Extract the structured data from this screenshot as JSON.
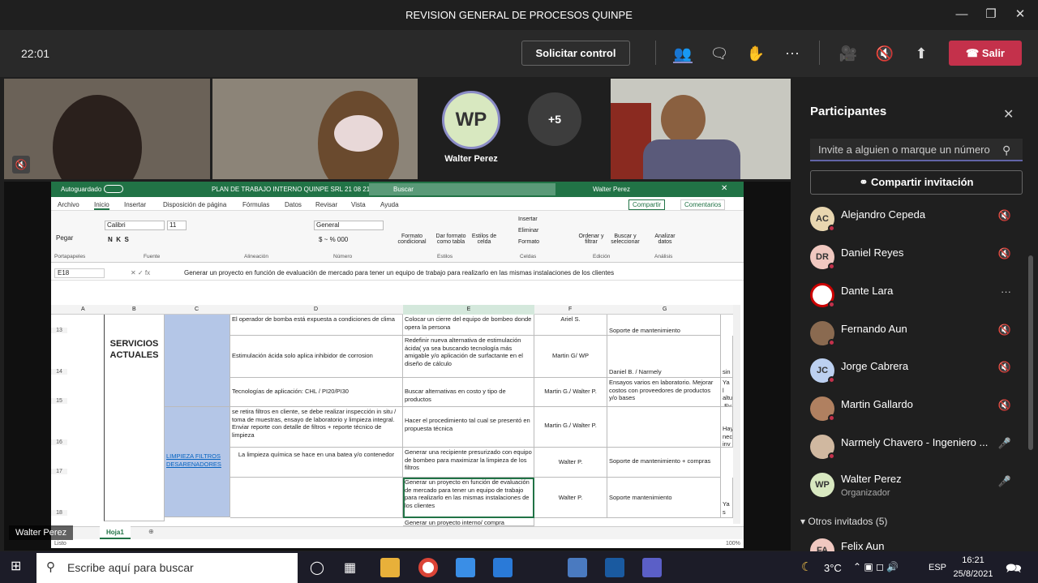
{
  "window": {
    "title": "REVISION GENERAL DE PROCESOS QUINPE"
  },
  "toolbar": {
    "clock": "22:01",
    "request_control": "Solicitar control",
    "leave": "Salir"
  },
  "video": {
    "center_initials": "WP",
    "center_name": "Walter Perez",
    "overflow": "+5",
    "speaker_label": "Walter Perez"
  },
  "excel": {
    "autosave": "Autoguardado",
    "filename": "PLAN DE TRABAJO INTERNO QUINPE SRL 21 08 21 -",
    "search": "Buscar",
    "user": "Walter Perez",
    "tabs": [
      "Archivo",
      "Inicio",
      "Insertar",
      "Disposición de página",
      "Fórmulas",
      "Datos",
      "Revisar",
      "Vista",
      "Ayuda"
    ],
    "share": "Compartir",
    "comments": "Comentarios",
    "ribbon_groups": [
      "Portapapeles",
      "Fuente",
      "Alineación",
      "Número",
      "Estilos",
      "Celdas",
      "Edición",
      "Análisis"
    ],
    "font_name": "Calibri",
    "font_size": "11",
    "number_format": "General",
    "ribbon_buttons": {
      "paste": "Pegar",
      "cond_format": "Formato condicional",
      "table_format": "Dar formato como tabla",
      "cell_styles": "Estilos de celda",
      "insert": "Insertar",
      "delete": "Eliminar",
      "format": "Formato",
      "sort": "Ordenar y filtrar",
      "find": "Buscar y seleccionar",
      "analyze": "Analizar datos"
    },
    "name_box": "E18",
    "formula": "Generar un proyecto en función de evaluación de mercado para tener un equipo de trabajo para realizarlo en las mismas instalaciones de los clientes",
    "columns": [
      "A",
      "B",
      "C",
      "D",
      "E",
      "F",
      "G"
    ],
    "rows": [
      "13",
      "14",
      "15",
      "16",
      "17",
      "18"
    ],
    "b_label": "SERVICIOS ACTUALES",
    "c_label": "LIMPIEZA FILTROS DESARENADORES",
    "cells": {
      "d13": "El operador de bomba está expuesta a condiciones de clima",
      "e13": "Colocar un cierre del equipo de bombeo donde opera la persona",
      "f13": "Ariel S.",
      "g13": "Soporte de mantenimiento",
      "d14": "Estimulación ácida solo aplica inhibidor de corrosion",
      "e14": "Redefinir nueva alternativa de estimulación ácida( ya sea buscando tecnología más amigable y/o aplicación de surfactante en el diseño de cálculo",
      "f14": "Martin G/ WP",
      "g14": "Daniel B. / Narmely",
      "h14": "sin",
      "d15": "Tecnologías de aplicación: CHL / PI20/PI30",
      "e15": "Buscar alternativas en costo y tipo de productos",
      "f15": "Martin G./ Walter P.",
      "g15": "Ensayos varios en laboratorio. Mejorar costos con proveedores de productos y/o bases",
      "h15": "Ya l altu .Ev",
      "d16": "se retira filtros en cliente, se debe realizar inspección in situ / toma de muestras, ensayo de laboratorio y limpieza integral. Enviar reporte con detalle de filtros + reporte técnico de limpieza",
      "e16": "Hacer el procedimiento tal cual se presentó en propuesta técnica",
      "f16": "Martin G./ Walter P.",
      "h16": "Hay nec inv",
      "d17": "La limpieza química se hace en una batea y/o contenedor",
      "e17": "Generar una recipiente presurizado con equipo de bombeo para maximizar la limpieza de los filtros",
      "f17": "Walter P.",
      "g17": "Soporte de mantenimiento + compras",
      "e18": "Generar un proyecto en función de evaluación de mercado para tener un equipo de trabajo para realizarlo en las mismas instalaciones de los clientes",
      "f18": "Walter P.",
      "g18": "Soporte mantenimiento",
      "h18": "Ya s Jua",
      "e19": "Generar un proyecto interno/ compra"
    },
    "sheet_tab": "Hoja1",
    "status": "Listo",
    "zoom": "100%"
  },
  "sidebar": {
    "title": "Participantes",
    "invite_placeholder": "Invite a alguien o marque un número",
    "share_invite": "Compartir invitación",
    "participants": [
      {
        "initials": "AC",
        "name": "Alejandro Cepeda",
        "sub": "",
        "mic": "🎙",
        "color": "#e8d6b0"
      },
      {
        "initials": "DR",
        "name": "Daniel Reyes",
        "sub": "",
        "mic": "🎙",
        "color": "#f0c8c0"
      },
      {
        "initials": "",
        "name": "Dante Lara",
        "sub": "",
        "mic": "···",
        "color": "#ffffff"
      },
      {
        "initials": "",
        "name": "Fernando Aun",
        "sub": "",
        "mic": "🎙",
        "color": "#8a6a50"
      },
      {
        "initials": "JC",
        "name": "Jorge Cabrera",
        "sub": "",
        "mic": "🎙",
        "color": "#bcd0f0"
      },
      {
        "initials": "",
        "name": "Martin Gallardo",
        "sub": "",
        "mic": "🎙",
        "color": "#b08060"
      },
      {
        "initials": "",
        "name": "Narmely Chavero - Ingeniero ...",
        "sub": "",
        "mic": "🎤",
        "color": "#d0b8a0"
      },
      {
        "initials": "WP",
        "name": "Walter Perez",
        "sub": "Organizador",
        "mic": "🎤",
        "color": "#d8e8c0"
      }
    ],
    "other_guests": "Otros invitados (5)",
    "guest": {
      "initials": "FA",
      "name": "Felix Aun"
    }
  },
  "taskbar": {
    "search_placeholder": "Escribe aquí para buscar",
    "temp": "3°C",
    "lang": "ESP",
    "time": "16:21",
    "date": "25/8/2021"
  }
}
